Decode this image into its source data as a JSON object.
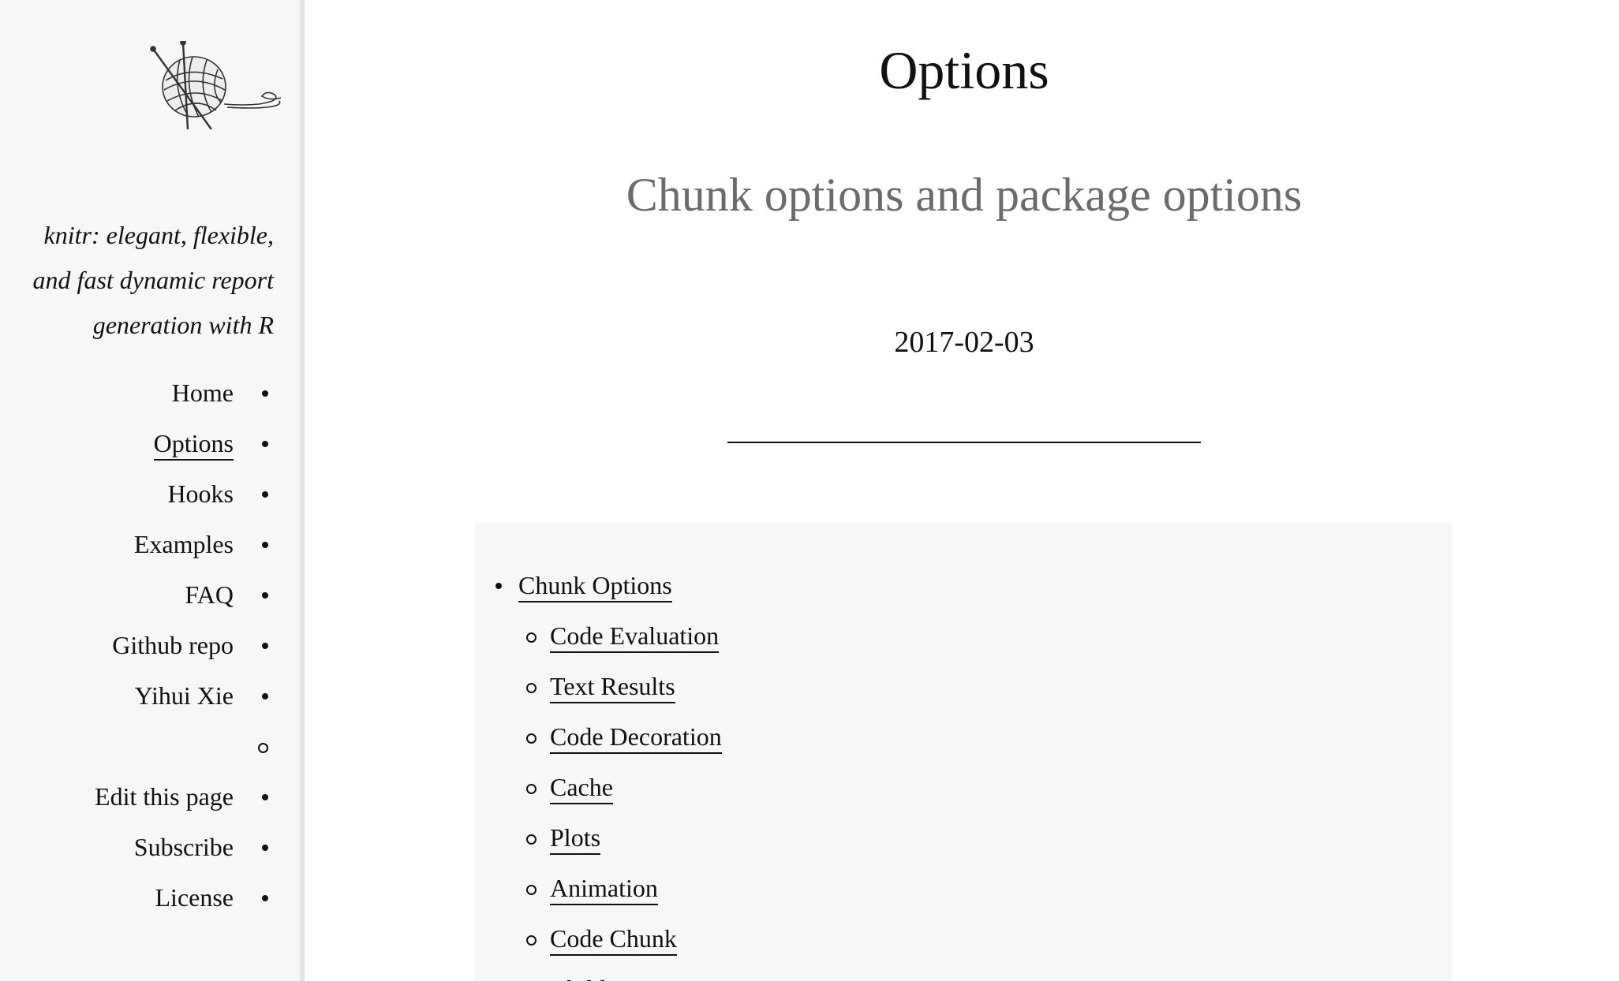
{
  "sidebar": {
    "tagline": "knitr: elegant, flexible, and fast dynamic report generation with R",
    "nav": [
      {
        "label": "Home",
        "active": false
      },
      {
        "label": "Options",
        "active": true
      },
      {
        "label": "Hooks",
        "active": false
      },
      {
        "label": "Examples",
        "active": false
      },
      {
        "label": "FAQ",
        "active": false
      },
      {
        "label": "Github repo",
        "active": false
      },
      {
        "label": "Yihui Xie",
        "active": false
      },
      {
        "label": "",
        "sub": true
      },
      {
        "label": "Edit this page",
        "active": false
      },
      {
        "label": "Subscribe",
        "active": false
      },
      {
        "label": "License",
        "active": false
      }
    ]
  },
  "main": {
    "title": "Options",
    "subtitle": "Chunk options and package options",
    "date": "2017-02-03",
    "toc": {
      "top": "Chunk Options",
      "items": [
        "Code Evaluation",
        "Text Results",
        "Code Decoration",
        "Cache",
        "Plots",
        "Animation",
        "Code Chunk",
        "Child Documents"
      ]
    }
  }
}
